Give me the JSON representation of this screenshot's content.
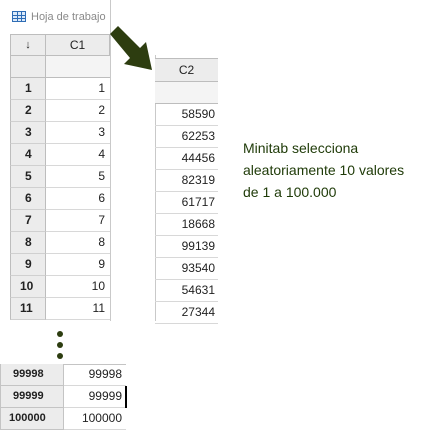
{
  "worksheet1": {
    "title": "Hoja de trabajo",
    "corner_label": "↓",
    "column_header": "C1",
    "rows": [
      {
        "row": "1",
        "value": "1"
      },
      {
        "row": "2",
        "value": "2"
      },
      {
        "row": "3",
        "value": "3"
      },
      {
        "row": "4",
        "value": "4"
      },
      {
        "row": "5",
        "value": "5"
      },
      {
        "row": "6",
        "value": "6"
      },
      {
        "row": "7",
        "value": "7"
      },
      {
        "row": "8",
        "value": "8"
      },
      {
        "row": "9",
        "value": "9"
      },
      {
        "row": "10",
        "value": "10"
      },
      {
        "row": "11",
        "value": "11"
      }
    ]
  },
  "worksheet2": {
    "column_header": "C2",
    "values": [
      "58590",
      "62253",
      "44456",
      "82319",
      "61717",
      "18668",
      "99139",
      "93540",
      "54631",
      "27344"
    ]
  },
  "note": {
    "lines": [
      "Minitab selecciona",
      "aleatoriamente 10 valores",
      "de 1 a 100.000"
    ]
  },
  "bottom_rows": [
    {
      "row": "99998",
      "value": "99998"
    },
    {
      "row": "99999",
      "value": "99999"
    },
    {
      "row": "100000",
      "value": "100000"
    }
  ],
  "colors": {
    "arrow": "#2d3d10",
    "note_text": "#1e3a07",
    "header_bg": "#ececec"
  },
  "icons": {
    "worksheet": "worksheet-icon",
    "arrow": "arrow-right-down-icon",
    "ellipsis": "vertical-ellipsis-icon"
  }
}
